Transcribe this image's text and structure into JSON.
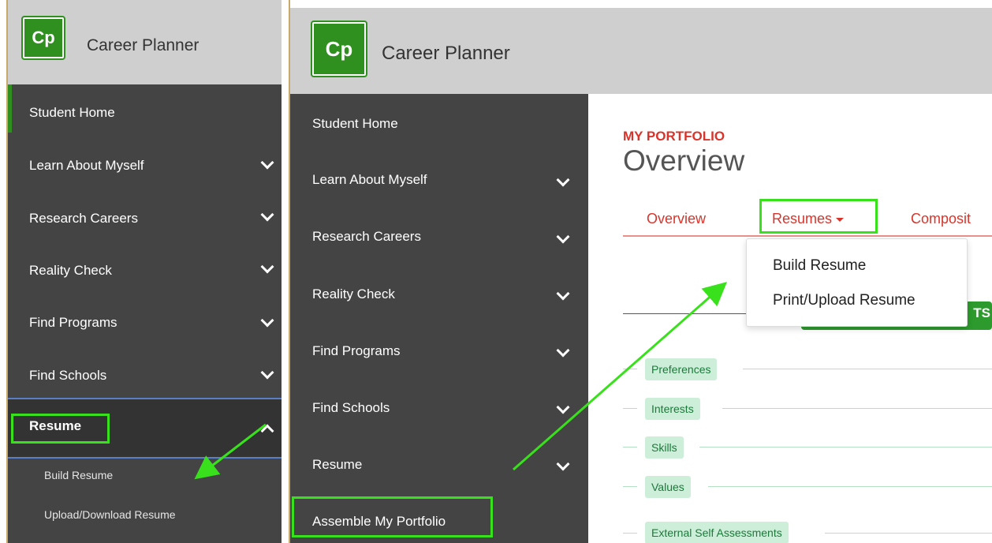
{
  "app": {
    "logo_text": "Cp",
    "brand_name": "Career Planner"
  },
  "left_panel": {
    "nav_items": [
      {
        "label": "Student Home"
      },
      {
        "label": "Learn About Myself"
      },
      {
        "label": "Research Careers"
      },
      {
        "label": "Reality Check"
      },
      {
        "label": "Find Programs"
      },
      {
        "label": "Find Schools"
      },
      {
        "label": "Resume"
      }
    ],
    "sub_items": [
      {
        "label": "Build Resume"
      },
      {
        "label": "Upload/Download Resume"
      }
    ]
  },
  "right_panel": {
    "nav_items": [
      {
        "label": "Student Home"
      },
      {
        "label": "Learn About Myself"
      },
      {
        "label": "Research Careers"
      },
      {
        "label": "Reality Check"
      },
      {
        "label": "Find Programs"
      },
      {
        "label": "Find Schools"
      },
      {
        "label": "Resume"
      },
      {
        "label": "Assemble My Portfolio"
      }
    ],
    "content": {
      "crumb": "MY PORTFOLIO",
      "title": "Overview",
      "tabs": [
        {
          "label": "Overview"
        },
        {
          "label": "Resumes"
        },
        {
          "label": "Composit"
        }
      ],
      "dropdown_options": [
        {
          "label": "Build Resume"
        },
        {
          "label": "Print/Upload Resume"
        }
      ],
      "partial_button_text": "TS",
      "pills": [
        {
          "label": "Preferences"
        },
        {
          "label": "Interests"
        },
        {
          "label": "Skills"
        },
        {
          "label": "Values"
        },
        {
          "label": "External Self Assessments"
        }
      ]
    }
  },
  "colors": {
    "brand_green": "#2f8f1f",
    "nav_bg": "#444444",
    "accent_red": "#d9342b",
    "highlight_green": "#39e01c"
  }
}
